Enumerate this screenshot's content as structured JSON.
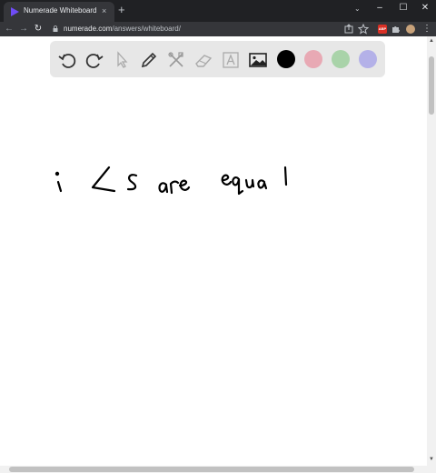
{
  "browser": {
    "tab_title": "Numerade Whiteboard",
    "tab_close": "×",
    "new_tab": "+",
    "url_domain": "numerade.com",
    "url_path": "/answers/whiteboard/",
    "window_minimize": "–",
    "window_maximize": "☐",
    "window_close": "✕",
    "tab_list": "⌄",
    "back": "←",
    "forward": "→",
    "reload": "↻",
    "menu": "⋮",
    "abp_label": "ABP"
  },
  "whiteboard": {
    "tools": [
      "undo-icon",
      "redo-icon",
      "select-icon",
      "pen-icon",
      "tools-icon",
      "eraser-icon",
      "text-icon",
      "image-icon"
    ],
    "colors": [
      "#000000",
      "#e8a9b4",
      "#a9d3a9",
      "#b4b1e8"
    ],
    "handwriting": "i ∠s are equal"
  },
  "colors": {
    "accent": "#6f4cf6",
    "chrome_dark": "#202124",
    "chrome_toolbar": "#35363a",
    "toolbar_bg": "#e7e7e7"
  }
}
